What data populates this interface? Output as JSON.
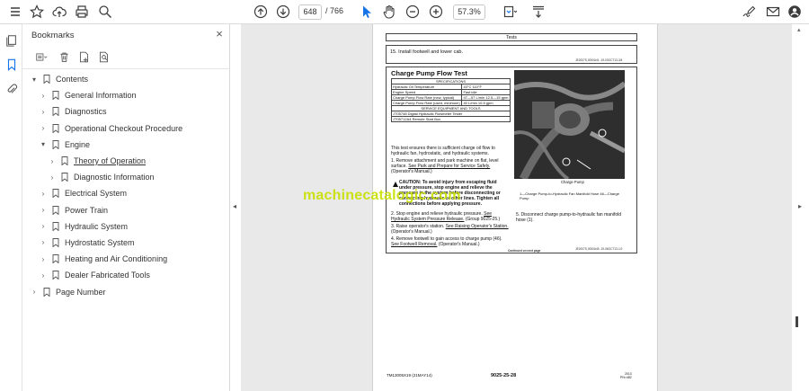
{
  "toolbar": {
    "current_page": "648",
    "page_total": "/ 766",
    "zoom": "57.3%"
  },
  "bookmarks": {
    "title": "Bookmarks",
    "close": "×",
    "items": [
      {
        "label": "Contents",
        "level": 0,
        "chevron": "▾"
      },
      {
        "label": "General Information",
        "level": 1,
        "chevron": "›"
      },
      {
        "label": "Diagnostics",
        "level": 1,
        "chevron": "›"
      },
      {
        "label": "Operational Checkout Procedure",
        "level": 1,
        "chevron": "›"
      },
      {
        "label": "Engine",
        "level": 1,
        "chevron": "▾"
      },
      {
        "label": "Theory of Operation",
        "level": 2,
        "chevron": "›",
        "selected": true
      },
      {
        "label": "Diagnostic Information",
        "level": 2,
        "chevron": "›"
      },
      {
        "label": "Electrical System",
        "level": 1,
        "chevron": "›"
      },
      {
        "label": "Power Train",
        "level": 1,
        "chevron": "›"
      },
      {
        "label": "Hydraulic System",
        "level": 1,
        "chevron": "›"
      },
      {
        "label": "Hydrostatic System",
        "level": 1,
        "chevron": "›"
      },
      {
        "label": "Heating and Air Conditioning",
        "level": 1,
        "chevron": "›"
      },
      {
        "label": "Dealer Fabricated Tools",
        "level": 1,
        "chevron": "›"
      },
      {
        "label": "Page Number",
        "level": 0,
        "chevron": "›"
      }
    ]
  },
  "document": {
    "tests_header": "Tests",
    "step15": "15. Install footwell and lower cab.",
    "ref1": "JE2007S,0000A41 -19-03OCT13-3/4",
    "title": "Charge Pump Flow Test",
    "spec_header": "SPECIFICATIONS",
    "specs": [
      [
        "Hydraulic Oil Temperature",
        "43°C\n110°F"
      ],
      [
        "Engine Speed",
        "Fast idle"
      ],
      [
        "Charge Pump Flow Rate (new, typical)",
        "47—57 L/min\n12.5—15 gpm"
      ],
      [
        "Charge Pump Flow Rate (used, minimum)",
        "40 L/min\n10.5 gpm"
      ]
    ],
    "tools_header": "SERVICE EQUIPMENT AND TOOLS",
    "tools": [
      "JT05748 Digital Hydraulic Flowmeter Tester",
      "JT05712A4 Remote Start Box"
    ],
    "intro": "This test ensures there is sufficient charge oil flow to hydraulic fan, hydrostatic, and hydraulic systems.",
    "step1": "1. Remove attachment and park machine on flat, level surface.",
    "step1_link": "See Park and Prepare for Service Safely.",
    "step1_tail": "(Operator's Manual.)",
    "caution": "CAUTION: To avoid injury from escaping fluid under pressure, stop engine and relieve the pressure in the system before disconnecting or connecting hydraulic or other lines. Tighten all connections before applying pressure.",
    "step2": "2. Stop engine and relieve hydraulic pressure.",
    "step2_link": "See Hydraulic System Pressure Release.",
    "step2_tail": "(Group 9025-25.)",
    "step3": "3. Raise operator's station.",
    "step3_link": "See Raising Operator's Station.",
    "step3_tail": "(Operator's Manual.)",
    "step4": "4. Remove footwell to gain access to charge pump (46).",
    "step4_link": "See Footwell Removal.",
    "step4_tail": "(Operator's Manual.)",
    "photo_caption": "Charge Pump",
    "legend": "1—Charge Pump-to-Hydraulic Fan Manifold Hose    46—Charge Pump",
    "step5": "5. Disconnect charge pump-to-hydraulic fan manifold hose (1).",
    "ref2": "JE2007S,0000A45 -19-06OCT13-1/2",
    "continued": "Continued on next page",
    "watermark": "machinecatalogic.com",
    "footer_left": "TM13005X19 (21MAY14)",
    "footer_mid": "9025-25-28",
    "footer_right": "2013\nPN=482"
  }
}
